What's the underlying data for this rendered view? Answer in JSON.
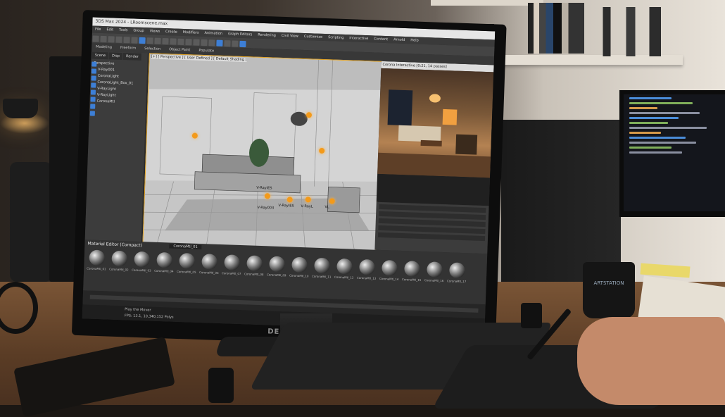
{
  "app": {
    "title": "3DS Max 2024 - LRoomscene.max",
    "menu": [
      "File",
      "Edit",
      "Tools",
      "Group",
      "Views",
      "Create",
      "Modifiers",
      "Animation",
      "Graph Editors",
      "Rendering",
      "Civil View",
      "Customize",
      "Scripting",
      "Interactive",
      "Content",
      "Arnold",
      "Help"
    ],
    "ribbon": [
      "Modeling",
      "Freeform",
      "Selection",
      "Object Paint",
      "Populate"
    ]
  },
  "scene_panel": {
    "tabs": [
      "Scene",
      "Disp",
      "Render"
    ],
    "root": "Perspective",
    "items": [
      "V-Ray001",
      "CoronaLight",
      "CoronaLight_Box_01",
      "V-RayLight",
      "V-RayLight",
      "CoronaMtl"
    ]
  },
  "viewport": {
    "label": "[+] [ Perspective ] [ User Defined ] [ Default Shading ]",
    "lights": [
      "V-RayIES",
      "V-RayIES",
      "V-Ray003",
      "V-RayL",
      "VL"
    ]
  },
  "render_window": {
    "title": "Corona Interactive [0:21, 14 passes]"
  },
  "material_editor": {
    "title": "Material Editor (Compact)",
    "material_name": "CoronaMtl_01",
    "swatches": [
      "CoronaMtl_01",
      "CoronaMtl_02",
      "CoronaMtl_03",
      "CoronaMtl_04",
      "CoronaMtl_05",
      "CoronaMtl_06",
      "CoronaMtl_07",
      "CoronaMtl_08",
      "CoronaMtl_09",
      "CoronaMtl_10",
      "CoronaMtl_11",
      "CoronaMtl_12",
      "CoronaMtl_13",
      "CoronaMtl_14",
      "CoronaMtl_15",
      "CoronaMtl_16",
      "CoronaMtl_17"
    ]
  },
  "status": {
    "line1": "Play the Mover",
    "line2": "FPS: 13.1, 10,340,152 Polys"
  },
  "desk": {
    "monitor_brand": "DELL",
    "mug_text": "ARTSTATION"
  },
  "colors": {
    "accent": "#3d7fd6",
    "light_orb": "#f39a1a",
    "viewport_border": "#e0a020"
  }
}
